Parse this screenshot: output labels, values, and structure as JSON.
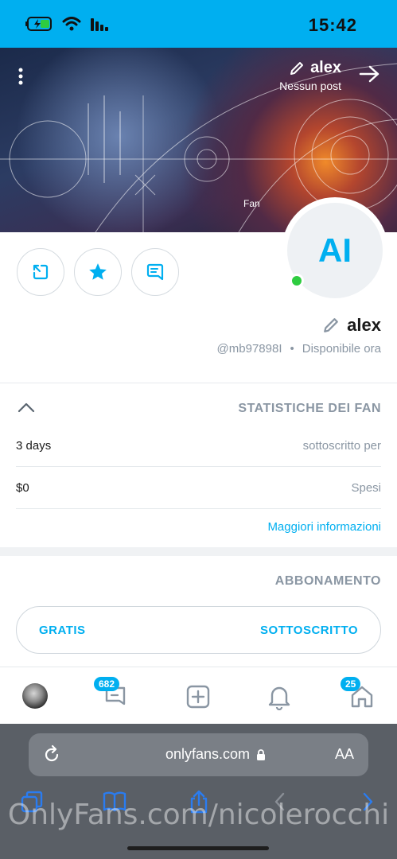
{
  "status_bar": {
    "time": "15:42",
    "bg_color": "#00aff0"
  },
  "cover": {
    "name": "alex",
    "subtitle": "Nessun post",
    "fan_label": "Fan"
  },
  "profile": {
    "initials": "AI",
    "name": "alex",
    "handle": "@mb97898I",
    "separator": "•",
    "availability": "Disponibile ora"
  },
  "fan_stats": {
    "title": "STATISTICHE DEI FAN",
    "rows": [
      {
        "label": "sottoscritto per",
        "value": "3 days"
      },
      {
        "label": "Spesi",
        "value": "$0"
      }
    ],
    "more_info": "Maggiori informazioni"
  },
  "subscription": {
    "title": "ABBONAMENTO",
    "status_label": "SOTTOSCRITTO",
    "price_label": "GRATIS"
  },
  "bottom_nav": {
    "home_badge": "25",
    "messages_badge": "682"
  },
  "browser": {
    "url": "onlyfans.com",
    "text_size_label": "AA",
    "watermark": "OnlyFans.com/nicolerocchi"
  },
  "colors": {
    "accent": "#00aff0",
    "online": "#2ecc40",
    "muted": "#8a96a3"
  },
  "icons": [
    "back-arrow-icon",
    "menu-dots-icon",
    "pencil-icon",
    "message-icon",
    "star-icon",
    "share-icon",
    "chevron-up-icon",
    "home-icon",
    "bell-icon",
    "add-post-icon",
    "chat-icon",
    "reload-icon",
    "lock-icon",
    "tabs-icon",
    "bookmarks-icon",
    "share-sheet-icon",
    "forward-icon"
  ]
}
